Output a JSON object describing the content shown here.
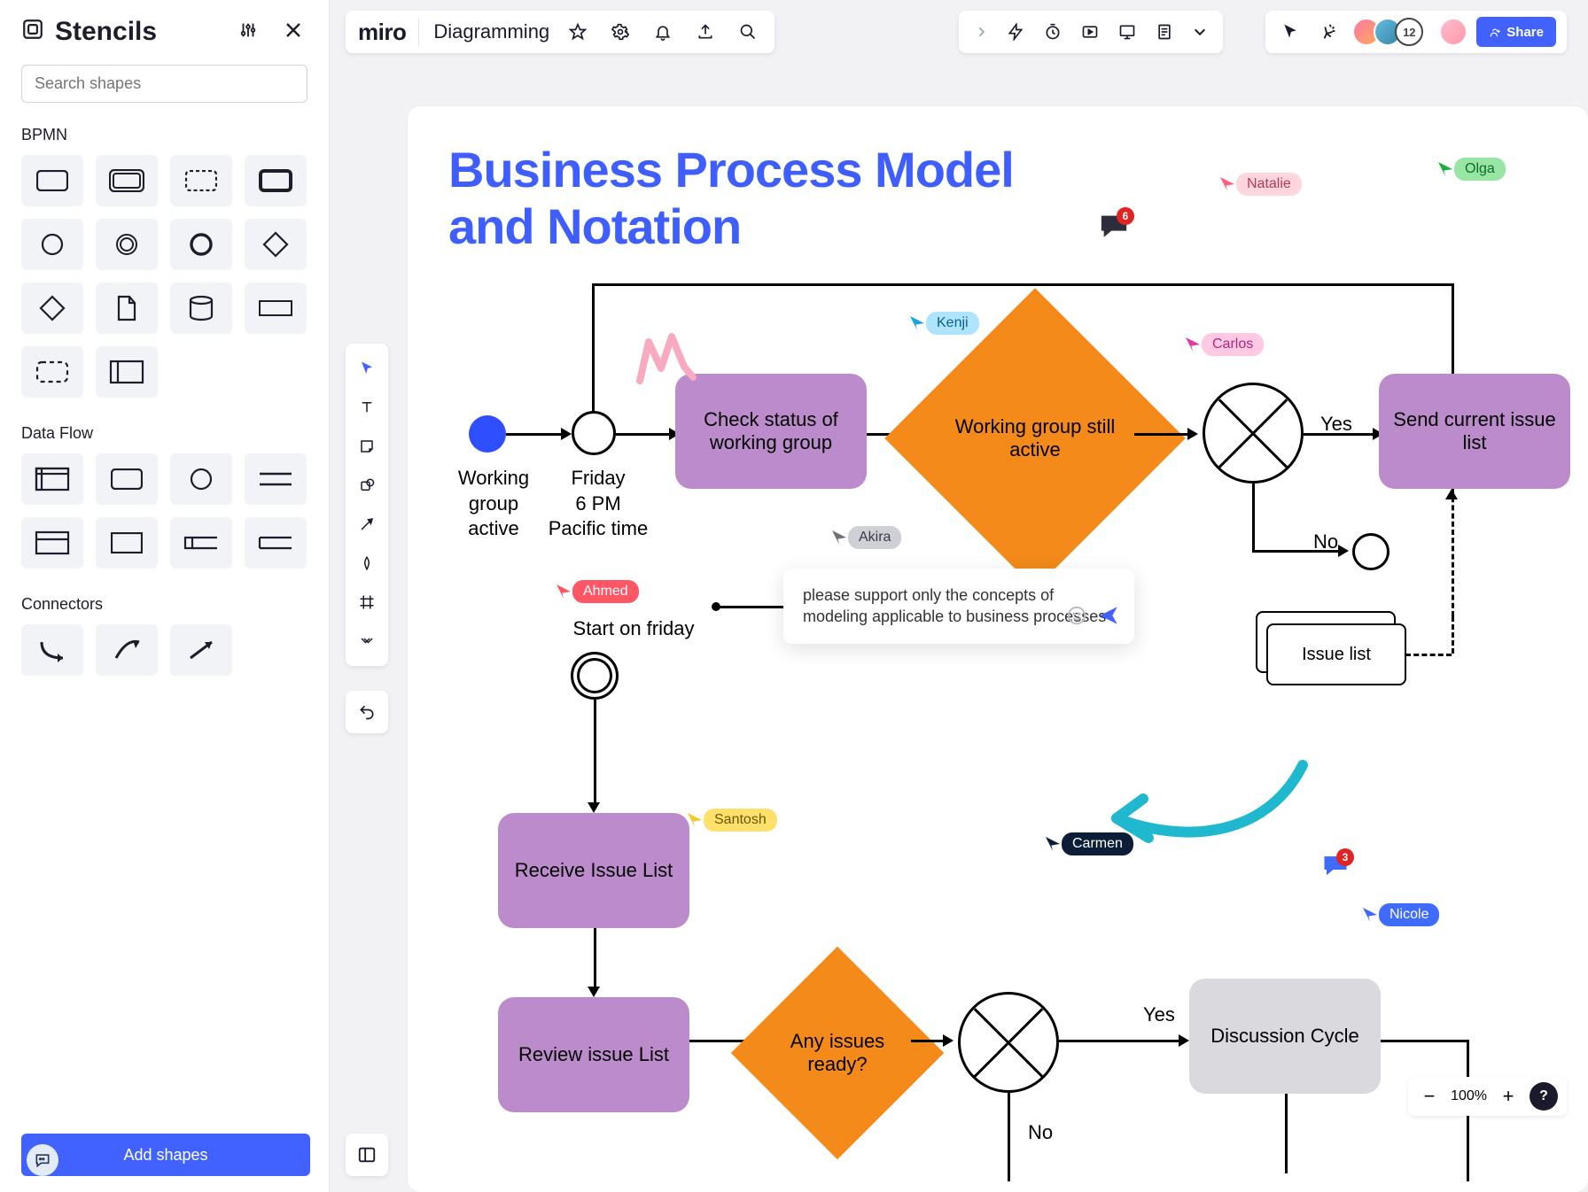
{
  "sidebar": {
    "title": "Stencils",
    "search_placeholder": "Search shapes",
    "sections": {
      "bpmn_label": "BPMN",
      "dataflow_label": "Data Flow",
      "connectors_label": "Connectors"
    },
    "add_shapes_label": "Add shapes"
  },
  "header": {
    "brand": "miro",
    "board_name": "Diagramming"
  },
  "collab": {
    "count": "12",
    "share_label": "Share"
  },
  "diagram": {
    "title_line1": "Business Process Model",
    "title_line2": "and Notation",
    "nodes": {
      "start_dot_label": "Working\ngroup\nactive",
      "timer_label": "Friday\n6 PM\nPacific time",
      "check_status": "Check status of working group",
      "still_active": "Working group still active",
      "yes1": "Yes",
      "no1": "No",
      "send_list": "Send current issue list",
      "issue_list": "Issue list",
      "start_friday": "Start on friday",
      "receive_list": "Receive Issue List",
      "review_list": "Review issue List",
      "any_ready": "Any issues ready?",
      "yes2": "Yes",
      "no2": "No",
      "discussion_cycle": "Discussion Cycle"
    },
    "comment_text": "please support only the concepts of modeling applicable to business processes",
    "chat_badges": {
      "dark": "6",
      "blue": "3"
    }
  },
  "cursors": {
    "kenji": {
      "name": "Kenji",
      "bg": "#aee4ff",
      "fg": "#0a5f8f",
      "ptr": "#17a5e6"
    },
    "natalie": {
      "name": "Natalie",
      "bg": "#ffd6de",
      "fg": "#b43a58",
      "ptr": "#ff5d7c"
    },
    "olga": {
      "name": "Olga",
      "bg": "#98e6a3",
      "fg": "#0d6b2b",
      "ptr": "#18b13c"
    },
    "carlos": {
      "name": "Carlos",
      "bg": "#ffc9e3",
      "fg": "#b1277a",
      "ptr": "#e33aa0"
    },
    "akira": {
      "name": "Akira",
      "bg": "#cfd0d6",
      "fg": "#3a3a42",
      "ptr": "#6f7077"
    },
    "ahmed": {
      "name": "Ahmed",
      "bg": "#ff5666",
      "fg": "#ffffff",
      "ptr": "#ff5666"
    },
    "santosh": {
      "name": "Santosh",
      "bg": "#ffe06a",
      "fg": "#6b5600",
      "ptr": "#f2c82a"
    },
    "carmen": {
      "name": "Carmen",
      "bg": "#0c1d37",
      "fg": "#ffffff",
      "ptr": "#0c1d37"
    },
    "nicole": {
      "name": "Nicole",
      "bg": "#3f6cff",
      "fg": "#ffffff",
      "ptr": "#3f6cff"
    }
  },
  "zoom": {
    "percent": "100%"
  }
}
